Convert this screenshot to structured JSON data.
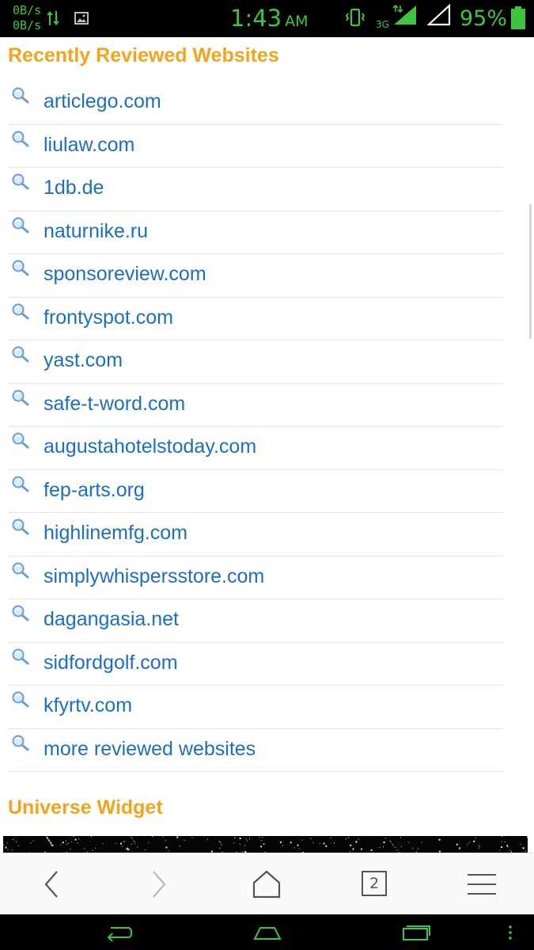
{
  "status_bar": {
    "net_up": "0B/s",
    "net_down": "0B/s",
    "time": "1:43",
    "ampm": "AM",
    "network_type": "3G",
    "battery_percent": "95%",
    "battery_level": 0.95,
    "accent_color": "#3ec43e"
  },
  "sections": {
    "recent": {
      "title": "Recently Reviewed Websites",
      "title_color": "#f4a31b",
      "link_color": "#1b6fc2",
      "items": [
        {
          "label": "articlego.com"
        },
        {
          "label": "liulaw.com"
        },
        {
          "label": "1db.de"
        },
        {
          "label": "naturnike.ru"
        },
        {
          "label": "sponsoreview.com"
        },
        {
          "label": "frontyspot.com"
        },
        {
          "label": "yast.com"
        },
        {
          "label": "safe-t-word.com"
        },
        {
          "label": "augustahotelstoday.com"
        },
        {
          "label": "fep-arts.org"
        },
        {
          "label": "highlinemfg.com"
        },
        {
          "label": "simplywhispersstore.com"
        },
        {
          "label": "dagangasia.net"
        },
        {
          "label": "sidfordgolf.com"
        },
        {
          "label": "kfyrtv.com"
        },
        {
          "label": "more reviewed websites"
        }
      ]
    },
    "widget": {
      "title": "Universe Widget"
    }
  },
  "toolbar": {
    "tab_count": "2",
    "icons": [
      "back-icon",
      "forward-icon",
      "home-icon",
      "tabs-icon",
      "menu-icon"
    ]
  },
  "navbar": {
    "icons": [
      "back-icon",
      "home-icon",
      "recent-apps-icon",
      "overflow-icon"
    ]
  }
}
